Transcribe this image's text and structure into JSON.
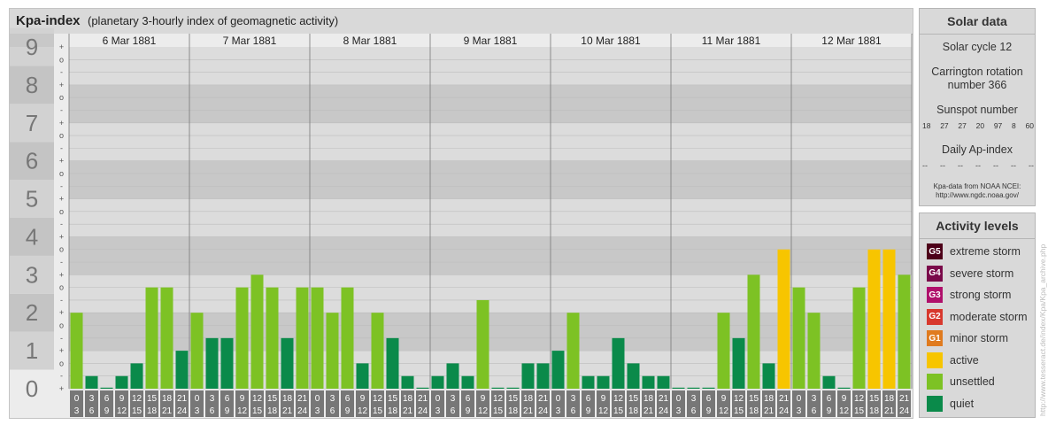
{
  "title": {
    "bold": "Kpa-index",
    "subtitle": "(planetary 3-hourly index of geomagnetic activity)"
  },
  "solar": {
    "title": "Solar data",
    "cycle": "Solar cycle 12",
    "carrington": "Carrington rotation number 366",
    "sunspot_label": "Sunspot number",
    "sunspot_values": [
      "18",
      "27",
      "27",
      "20",
      "97",
      "8",
      "60"
    ],
    "ap_label": "Daily Ap-index",
    "ap_values": [
      "--",
      "--",
      "--",
      "--",
      "--",
      "--",
      "--"
    ],
    "source_line1": "Kpa-data from NOAA NCEI:",
    "source_line2": "http://www.ngdc.noaa.gov/"
  },
  "activity": {
    "title": "Activity levels",
    "levels": [
      {
        "badge": "G5",
        "label": "extreme storm",
        "color": "#4d0019"
      },
      {
        "badge": "G4",
        "label": "severe storm",
        "color": "#7a0a4a"
      },
      {
        "badge": "G3",
        "label": "strong storm",
        "color": "#b0106b"
      },
      {
        "badge": "G2",
        "label": "moderate storm",
        "color": "#d8382d"
      },
      {
        "badge": "G1",
        "label": "minor storm",
        "color": "#e07b1f"
      },
      {
        "badge": "",
        "label": "active",
        "color": "#f7c500"
      },
      {
        "badge": "",
        "label": "unsettled",
        "color": "#7dc224"
      },
      {
        "badge": "",
        "label": "quiet",
        "color": "#0a8a4a"
      }
    ]
  },
  "watermark": "http://www.tesseract.de/index/Kpa/Kpa_archive.php",
  "chart_data": {
    "type": "bar",
    "title": "Kpa-index",
    "subtitle": "(planetary 3-hourly index of geomagnetic activity)",
    "ylim": [
      0,
      9
    ],
    "y_ticks": [
      "0",
      "1",
      "2",
      "3",
      "4",
      "5",
      "6",
      "7",
      "8",
      "9"
    ],
    "sub_ticks": [
      "+",
      "-",
      "o"
    ],
    "days": [
      "6 Mar 1881",
      "7 Mar 1881",
      "8 Mar 1881",
      "9 Mar 1881",
      "10 Mar 1881",
      "11 Mar 1881",
      "12 Mar 1881"
    ],
    "interval_top": [
      "0",
      "3",
      "6",
      "9",
      "12",
      "15",
      "18",
      "21"
    ],
    "interval_bottom": [
      "3",
      "6",
      "9",
      "12",
      "15",
      "18",
      "21",
      "24"
    ],
    "values": [
      [
        2.0,
        0.333,
        0.0,
        0.333,
        0.667,
        2.667,
        2.667,
        1.0
      ],
      [
        2.0,
        1.333,
        1.333,
        2.667,
        3.0,
        2.667,
        1.333,
        2.667
      ],
      [
        2.667,
        2.0,
        2.667,
        0.667,
        2.0,
        1.333,
        0.333,
        0.0
      ],
      [
        0.333,
        0.667,
        0.333,
        2.333,
        0.0,
        0.0,
        0.667,
        0.667
      ],
      [
        1.0,
        2.0,
        0.333,
        0.333,
        1.333,
        0.667,
        0.333,
        0.333
      ],
      [
        0.0,
        0.0,
        0.0,
        2.0,
        1.333,
        3.0,
        0.667,
        3.667
      ],
      [
        2.667,
        2.0,
        0.333,
        0.0,
        2.667,
        3.667,
        3.667,
        3.0
      ]
    ],
    "color_thresholds": {
      "quiet": "#0a8a4a",
      "unsettled": "#7dc224",
      "active": "#f7c500"
    }
  }
}
